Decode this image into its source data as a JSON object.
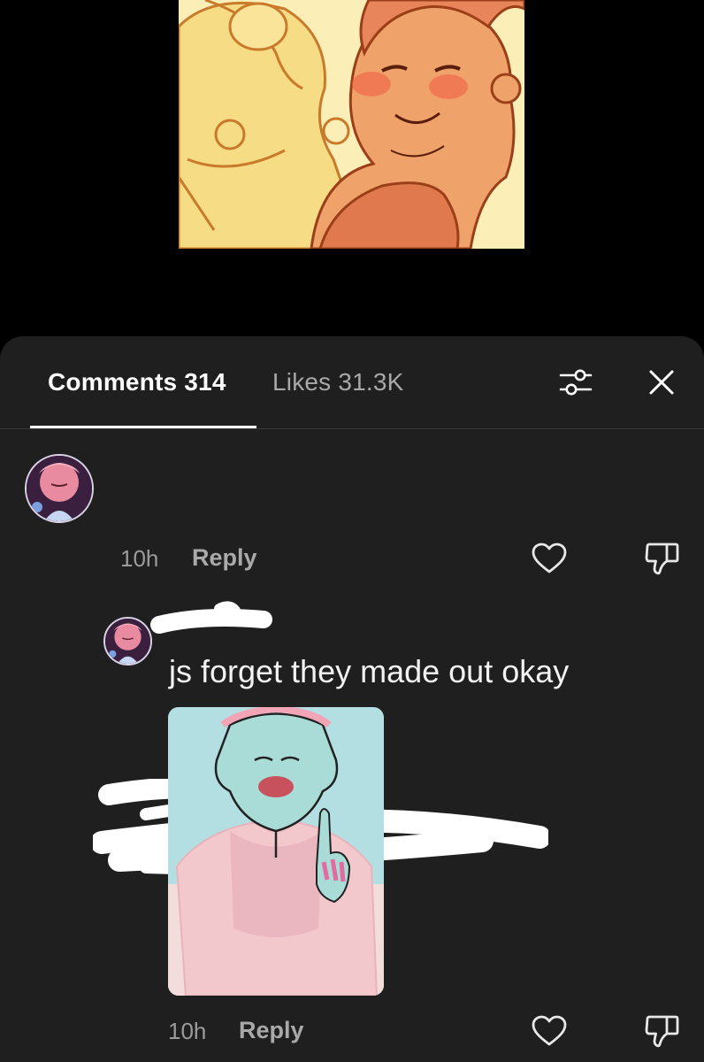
{
  "video": {
    "icon": "artwork-thumbnail"
  },
  "header": {
    "comments_label": "Comments 314",
    "likes_label": "Likes 31.3K",
    "filter_icon": "sliders-icon",
    "close_icon": "close-icon"
  },
  "comments": [
    {
      "time": "10h",
      "reply_label": "Reply",
      "like_icon": "heart-icon",
      "dislike_icon": "thumbs-down-icon"
    },
    {
      "text": "js forget they made out okay",
      "time": "10h",
      "reply_label": "Reply",
      "like_icon": "heart-icon",
      "dislike_icon": "thumbs-down-icon"
    }
  ],
  "colors": {
    "sheet_background": "#1f1f1f",
    "page_background": "#000000",
    "active_tab": "#ffffff",
    "inactive_tab": "#a8a8a8",
    "meta_text": "#9b9b9b"
  }
}
